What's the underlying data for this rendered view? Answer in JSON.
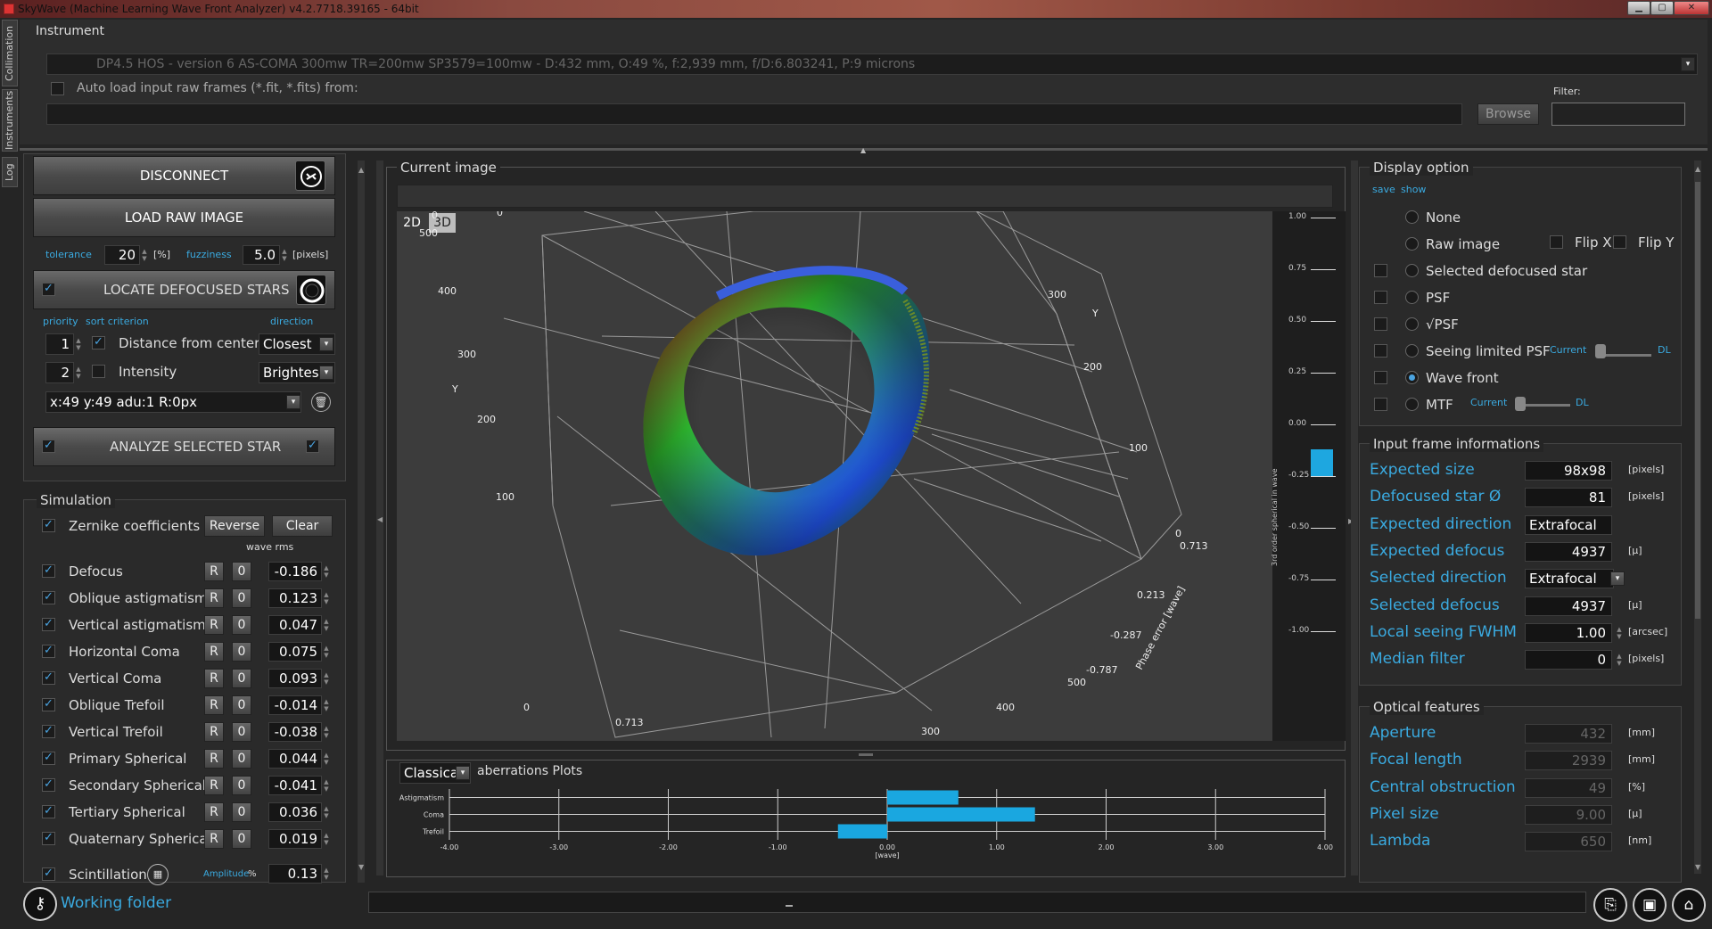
{
  "window": {
    "title": "SkyWave (Machine Learning Wave Front Analyzer) v4.2.7718.39165 - 64bit"
  },
  "side_tabs": [
    "Collimation",
    "Instruments",
    "Log"
  ],
  "instrument": {
    "group_title": "Instrument",
    "selected": "DP4.5 HOS - version 6 AS-COMA 300mw TR=200mw SP3579=100mw  - D:432 mm, O:49 %, f:2,939 mm, f/D:6.803241, P:9 microns",
    "autoload_label": "Auto load input raw frames (*.fit, *.fits) from:",
    "autoload_path": "",
    "browse_label": "Browse",
    "filter_label": "Filter:",
    "filter_value": ""
  },
  "left": {
    "disconnect_label": "DISCONNECT",
    "load_raw_label": "LOAD RAW IMAGE",
    "tolerance_label": "tolerance",
    "tolerance_value": "20",
    "tolerance_unit": "[%]",
    "fuzziness_label": "fuzziness",
    "fuzziness_value": "5.0",
    "fuzziness_unit": "[pixels]",
    "locate_label": "LOCATE DEFOCUSED STARS",
    "priority_label": "priority",
    "sort_label": "sort criterion",
    "direction_label": "direction",
    "criteria": [
      {
        "priority": "1",
        "name": "Distance from center",
        "direction": "Closest",
        "checked": true
      },
      {
        "priority": "2",
        "name": "Intensity",
        "direction": "Brightest",
        "checked": false
      }
    ],
    "star_info": "x:49 y:49 adu:1 R:0px",
    "analyze_label": "ANALYZE SELECTED STAR",
    "simulation_title": "Simulation",
    "zernike_label": "Zernike coefficients",
    "reverse_label": "Reverse",
    "clear_label": "Clear",
    "wave_rms_label": "wave rms",
    "coefficients": [
      {
        "name": "Defocus",
        "value": "-0.186"
      },
      {
        "name": "Oblique astigmatism",
        "value": "0.123"
      },
      {
        "name": "Vertical astigmatism",
        "value": "0.047"
      },
      {
        "name": "Horizontal Coma",
        "value": "0.075"
      },
      {
        "name": "Vertical Coma",
        "value": "0.093"
      },
      {
        "name": "Oblique Trefoil",
        "value": "-0.014"
      },
      {
        "name": "Vertical Trefoil",
        "value": "-0.038"
      },
      {
        "name": "Primary Spherical",
        "value": "0.044"
      },
      {
        "name": "Secondary Spherical",
        "value": "-0.041"
      },
      {
        "name": "Tertiary Spherical",
        "value": "0.036"
      },
      {
        "name": "Quaternary Spherical",
        "value": "0.019"
      }
    ],
    "r_label": "R",
    "zero_label": "0",
    "scintillation_label": "Scintillation",
    "amplitude_label": "Amplitude",
    "amplitude_unit": "%",
    "amplitude_value": "0.13",
    "working_folder_label": "Working folder"
  },
  "center": {
    "current_image_title": "Current image",
    "tab_2d": "2D",
    "tab_3d": "3D",
    "plot3d": {
      "y_ticks": [
        "100",
        "0",
        "500",
        "400",
        "300",
        "200",
        "100",
        "0"
      ],
      "x_ticks": [
        "300",
        "200",
        "100",
        "0",
        "500",
        "400",
        "300"
      ],
      "z_ticks": [
        "0.713",
        "0.213",
        "-0.287",
        "-0.787",
        "0.713"
      ],
      "y_label": "Y",
      "z_label": "Phase error [wave]",
      "x_label": "Ph"
    },
    "colorbar": {
      "label": "3rd order spherical in wave",
      "ticks": [
        "1.00",
        "0.75",
        "0.50",
        "0.25",
        "0.00",
        "-0.25",
        "-0.50",
        "-0.75",
        "-1.00"
      ],
      "marker_color": "#1ea7e0"
    },
    "plot_type": "Classical",
    "plots_title": "aberrations Plots"
  },
  "chart_data": {
    "type": "bar",
    "orientation": "horizontal",
    "categories": [
      "Astigmatism",
      "Coma",
      "Trefoil"
    ],
    "values": [
      0.65,
      1.35,
      -0.45
    ],
    "xlim": [
      -4,
      4
    ],
    "x_ticks": [
      "-4.00",
      "-3.00",
      "-2.00",
      "-1.00",
      "0.00",
      "1.00",
      "2.00",
      "3.00",
      "4.00"
    ],
    "xlabel": "[wave]",
    "color": "#1aa7e0",
    "grid": true
  },
  "right": {
    "display_title": "Display option",
    "save_label": "save",
    "show_label": "show",
    "options": [
      {
        "label": "None",
        "selected": false,
        "show_check": false
      },
      {
        "label": "Raw image",
        "selected": false,
        "show_check": false
      },
      {
        "label": "Selected defocused star",
        "selected": false,
        "show_check": true
      },
      {
        "label": "PSF",
        "selected": false,
        "show_check": true
      },
      {
        "label": "√PSF",
        "selected": false,
        "show_check": true
      },
      {
        "label": "Seeing limited PSF",
        "selected": false,
        "show_check": true
      },
      {
        "label": "Wave front",
        "selected": true,
        "show_check": true
      },
      {
        "label": "MTF",
        "selected": false,
        "show_check": true
      }
    ],
    "flipx_label": "Flip X",
    "flipy_label": "Flip Y",
    "current_label": "Current",
    "dl_label": "DL",
    "input_title": "Input frame informations",
    "input_rows": [
      {
        "label": "Expected size",
        "value": "98x98",
        "unit": "[pixels]"
      },
      {
        "label": "Defocused star Ø",
        "value": "81",
        "unit": "[pixels]"
      },
      {
        "label": "Expected direction",
        "value": "Extrafocal",
        "unit": ""
      },
      {
        "label": "Expected defocus",
        "value": "4937",
        "unit": "[µ]"
      },
      {
        "label": "Selected direction",
        "value": "Extrafocal",
        "unit": ""
      },
      {
        "label": "Selected defocus",
        "value": "4937",
        "unit": "[µ]"
      },
      {
        "label": "Local seeing FWHM",
        "value": "1.00",
        "unit": "[arcsec]"
      },
      {
        "label": "Median filter",
        "value": "0",
        "unit": "[pixels]"
      }
    ],
    "optical_title": "Optical features",
    "optical_rows": [
      {
        "label": "Aperture",
        "value": "432",
        "unit": "[mm]"
      },
      {
        "label": "Focal length",
        "value": "2939",
        "unit": "[mm]"
      },
      {
        "label": "Central obstruction",
        "value": "49",
        "unit": "[%]"
      },
      {
        "label": "Pixel size",
        "value": "9.00",
        "unit": "[µ]"
      },
      {
        "label": "Lambda",
        "value": "650",
        "unit": "[nm]"
      }
    ]
  }
}
